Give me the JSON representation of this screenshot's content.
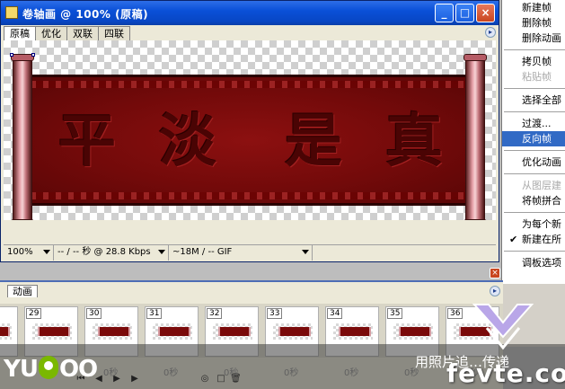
{
  "window": {
    "title": "卷轴画 @ 100% (原稿)",
    "minimize_label": "_",
    "maximize_label": "□",
    "close_label": "×"
  },
  "tabs": [
    {
      "label": "原稿",
      "active": true
    },
    {
      "label": "优化",
      "active": false
    },
    {
      "label": "双联",
      "active": false
    },
    {
      "label": "四联",
      "active": false
    }
  ],
  "canvas": {
    "banner_chars": [
      "平",
      "淡",
      "是",
      "真"
    ]
  },
  "statusbar": {
    "zoom": "100%",
    "speed": "-- / -- 秒 @ 28.8 Kbps",
    "size": "~18M / -- GIF"
  },
  "context_menu": {
    "items": [
      {
        "label": "新建帧",
        "state": "normal"
      },
      {
        "label": "删除帧",
        "state": "normal"
      },
      {
        "label": "删除动画",
        "state": "normal"
      },
      {
        "sep": true
      },
      {
        "label": "拷贝帧",
        "state": "normal"
      },
      {
        "label": "粘贴帧",
        "state": "disabled"
      },
      {
        "sep": true
      },
      {
        "label": "选择全部",
        "state": "normal"
      },
      {
        "sep": true
      },
      {
        "label": "过渡...",
        "state": "normal"
      },
      {
        "label": "反向帧",
        "state": "highlighted"
      },
      {
        "sep": true
      },
      {
        "label": "优化动画",
        "state": "normal"
      },
      {
        "sep": true
      },
      {
        "label": "从图层建",
        "state": "disabled"
      },
      {
        "label": "将帧拼合",
        "state": "normal"
      },
      {
        "sep": true
      },
      {
        "label": "为每个新",
        "state": "normal"
      },
      {
        "label": "新建在所",
        "state": "checked"
      },
      {
        "sep": true
      },
      {
        "label": "调板选项",
        "state": "normal"
      }
    ]
  },
  "panel": {
    "tab": "动画",
    "close_label": "×",
    "frames": [
      {
        "num": ""
      },
      {
        "num": "29"
      },
      {
        "num": "30"
      },
      {
        "num": "31"
      },
      {
        "num": "32"
      },
      {
        "num": "33"
      },
      {
        "num": "34"
      },
      {
        "num": "35"
      },
      {
        "num": "36"
      }
    ],
    "delay": "0秒"
  },
  "watermarks": {
    "yupoo_left": "YU",
    "yupoo_right": "OO",
    "chinese_caption": "用照片追…传递",
    "fevte": "fevte.com"
  },
  "colors": {
    "titlebar": "#0a50d8",
    "menu_highlight": "#316ac5",
    "banner_red": "#730a0a",
    "roller_pink": "#e6a0a8"
  }
}
